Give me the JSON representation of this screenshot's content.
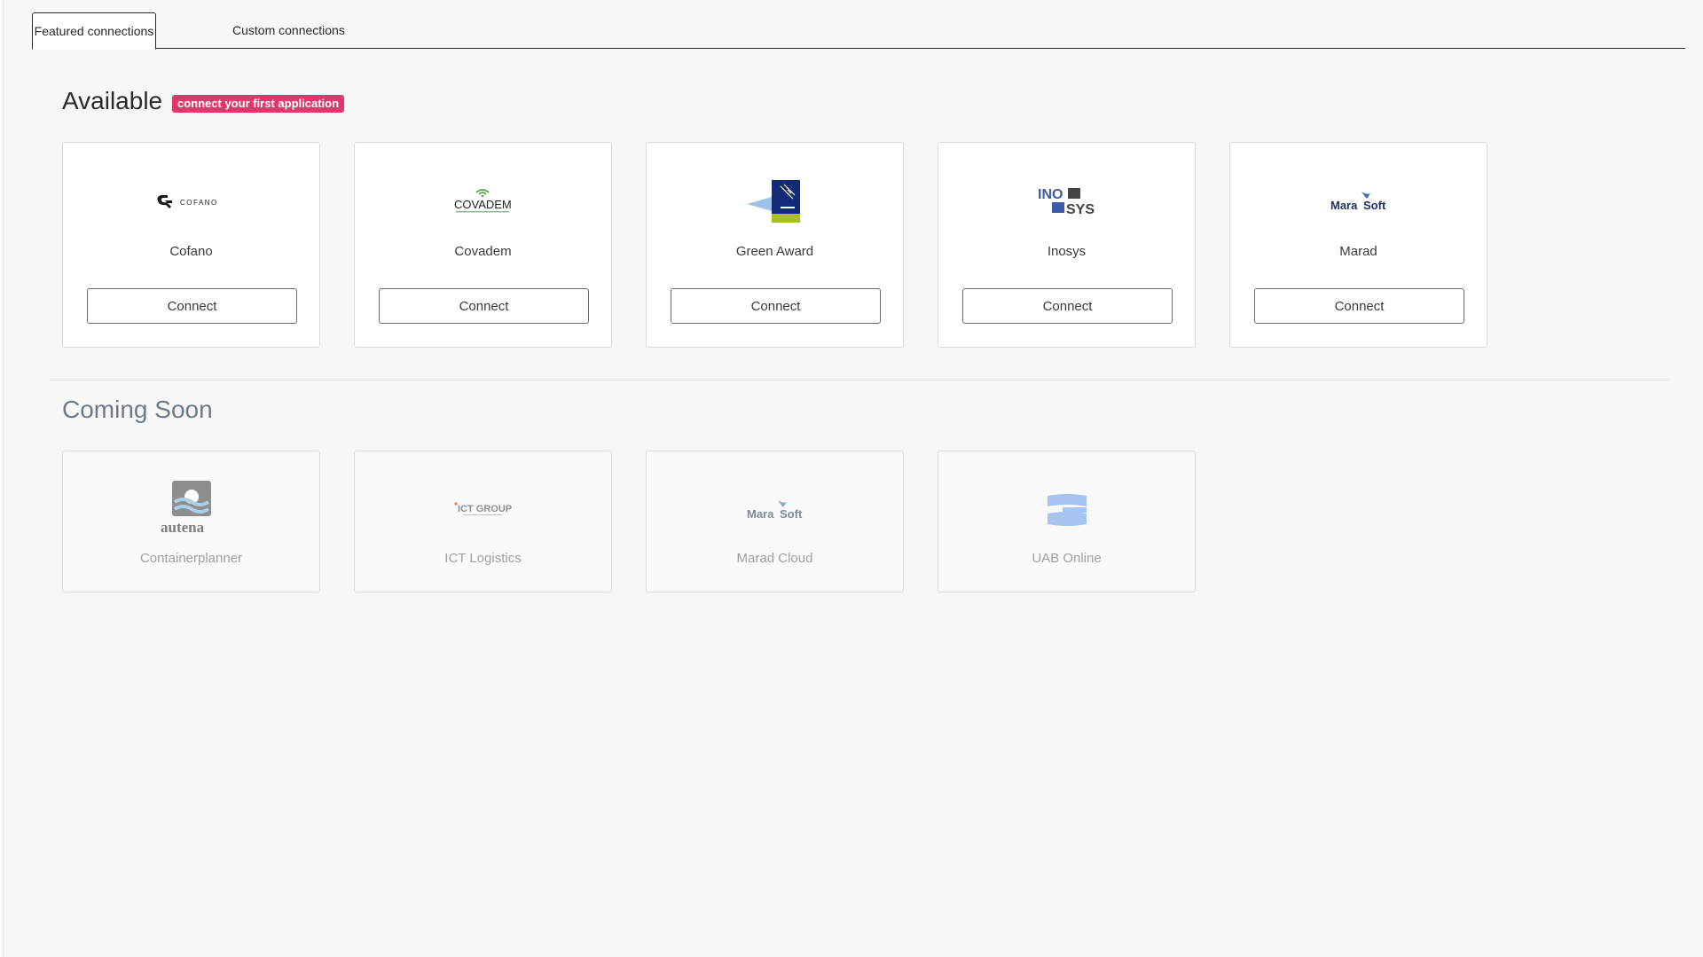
{
  "tabs": {
    "featured": "Featured connections",
    "custom": "Custom connections"
  },
  "available": {
    "title": "Available",
    "badge": "connect your first application",
    "connect_label": "Connect",
    "apps": [
      {
        "name": "Cofano",
        "logo_text": "COFANO"
      },
      {
        "name": "Covadem",
        "logo_text": "COVADEM"
      },
      {
        "name": "Green Award",
        "logo_text": ""
      },
      {
        "name": "Inosys",
        "logo_text": "INO SYS"
      },
      {
        "name": "Marad",
        "logo_text": "Mara Soft"
      }
    ]
  },
  "coming_soon": {
    "title": "Coming Soon",
    "apps": [
      {
        "name": "Containerplanner",
        "logo_text": "autena"
      },
      {
        "name": "ICT Logistics",
        "logo_text": "ICT GROUP"
      },
      {
        "name": "Marad Cloud",
        "logo_text": "Mara Soft"
      },
      {
        "name": "UAB Online",
        "logo_text": ""
      }
    ]
  },
  "colors": {
    "badge": "#e3376b",
    "background": "#f7f7f7",
    "coming_soon_title": "#6f7a89"
  }
}
